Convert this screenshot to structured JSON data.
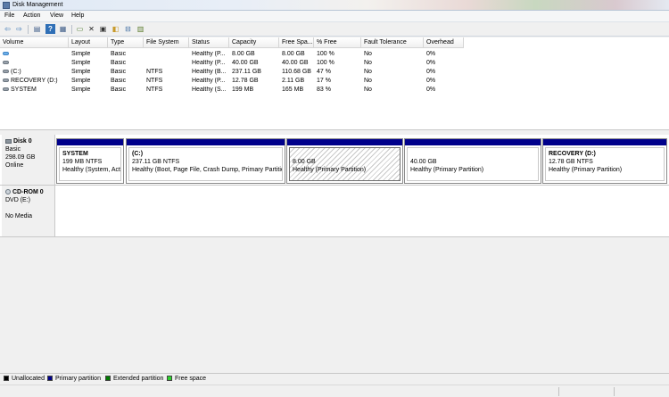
{
  "window": {
    "title": "Disk Management"
  },
  "menu": [
    "File",
    "Action",
    "View",
    "Help"
  ],
  "toolbar": [
    {
      "name": "back-icon",
      "glyph": "⇦"
    },
    {
      "name": "forward-icon",
      "glyph": "⇨"
    },
    {
      "name": "properties-icon",
      "glyph": "▤"
    },
    {
      "name": "help-icon",
      "glyph": "?"
    },
    {
      "name": "refresh-console-icon",
      "glyph": "▦"
    },
    {
      "name": "new-document-icon",
      "glyph": "▭"
    },
    {
      "name": "delete-icon",
      "glyph": "✕"
    },
    {
      "name": "format-icon",
      "glyph": "▣"
    },
    {
      "name": "open-folder-icon",
      "glyph": "◧"
    },
    {
      "name": "search-icon",
      "glyph": "⊟"
    },
    {
      "name": "rescan-disks-icon",
      "glyph": "▥"
    }
  ],
  "volume_table": {
    "columns": [
      "Volume",
      "Layout",
      "Type",
      "File System",
      "Status",
      "Capacity",
      "Free Spa...",
      "% Free",
      "Fault Tolerance",
      "Overhead"
    ],
    "rows": [
      {
        "volume": "",
        "icon": "blue",
        "layout": "Simple",
        "type": "Basic",
        "fs": "",
        "status": "Healthy (P...",
        "capacity": "8.00 GB",
        "free": "8.00 GB",
        "pct": "100 %",
        "fault": "No",
        "overhead": "0%"
      },
      {
        "volume": "",
        "icon": "gray",
        "layout": "Simple",
        "type": "Basic",
        "fs": "",
        "status": "Healthy (P...",
        "capacity": "40.00 GB",
        "free": "40.00 GB",
        "pct": "100 %",
        "fault": "No",
        "overhead": "0%"
      },
      {
        "volume": "(C:)",
        "icon": "gray",
        "layout": "Simple",
        "type": "Basic",
        "fs": "NTFS",
        "status": "Healthy (B...",
        "capacity": "237.11 GB",
        "free": "110.68 GB",
        "pct": "47 %",
        "fault": "No",
        "overhead": "0%"
      },
      {
        "volume": "RECOVERY (D:)",
        "icon": "gray",
        "layout": "Simple",
        "type": "Basic",
        "fs": "NTFS",
        "status": "Healthy (P...",
        "capacity": "12.78 GB",
        "free": "2.11 GB",
        "pct": "17 %",
        "fault": "No",
        "overhead": "0%"
      },
      {
        "volume": "SYSTEM",
        "icon": "gray",
        "layout": "Simple",
        "type": "Basic",
        "fs": "NTFS",
        "status": "Healthy (S...",
        "capacity": "199 MB",
        "free": "165 MB",
        "pct": "83 %",
        "fault": "No",
        "overhead": "0%"
      }
    ]
  },
  "disks": {
    "disk0": {
      "name": "Disk 0",
      "type": "Basic",
      "size": "298.09 GB",
      "state": "Online",
      "partitions": [
        {
          "name": "SYSTEM",
          "size": "199 MB NTFS",
          "status": "Healthy (System, Active, Primary Partition)"
        },
        {
          "name": "(C:)",
          "size": "237.11 GB NTFS",
          "status": "Healthy (Boot, Page File, Crash Dump, Primary Partition)"
        },
        {
          "name": "",
          "size": "8.00 GB",
          "status": "Healthy (Primary Partition)"
        },
        {
          "name": "",
          "size": "40.00 GB",
          "status": "Healthy (Primary Partition)"
        },
        {
          "name": "RECOVERY  (D:)",
          "size": "12.78 GB NTFS",
          "status": "Healthy (Primary Partition)"
        }
      ]
    },
    "cdrom0": {
      "name": "CD-ROM 0",
      "drive": "DVD (E:)",
      "state": "No Media"
    }
  },
  "legend": [
    {
      "label": "Unallocated",
      "color": "#000000"
    },
    {
      "label": "Primary partition",
      "color": "#00008b"
    },
    {
      "label": "Extended partition",
      "color": "#007a00"
    },
    {
      "label": "Free space",
      "color": "#2ed12e"
    }
  ]
}
